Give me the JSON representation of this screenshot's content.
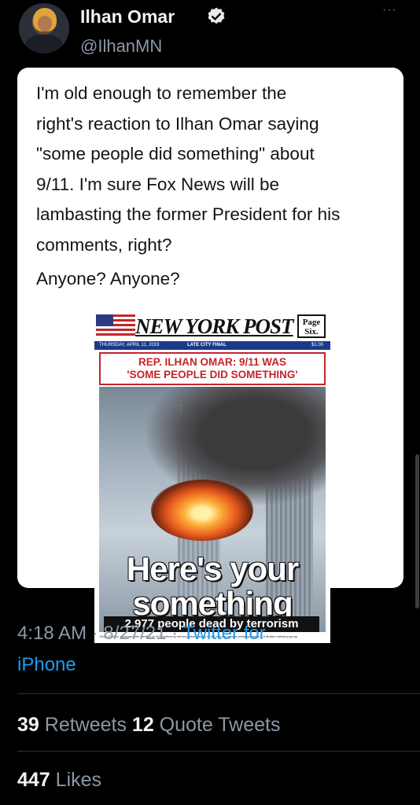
{
  "tweet": {
    "author_name": "Ilhan Omar",
    "author_handle": "@IlhanMN",
    "more_label": "···",
    "quoted_text": [
      "I'm old enough to remember the",
      "right's reaction to Ilhan Omar saying",
      "\"some people did something\" about",
      "9/11. I'm sure Fox News will be",
      "lambasting the former President for his",
      "comments, right?"
    ],
    "quoted_text_2": "Anyone? Anyone?",
    "timestamp": "4:18 AM · 8/27/21 · ",
    "source_line1": "Twitter for",
    "source_line2": "iPhone",
    "retweets_count": "39",
    "retweets_label": " Retweets ",
    "quotes_count": "12",
    "quotes_label": " Quote Tweets",
    "likes_count": "447",
    "likes_label": " Likes"
  },
  "newspaper": {
    "masthead": "NEW YORK POST",
    "page_six": "Page Six.",
    "dateline": "THURSDAY, APRIL 11, 2019",
    "edition": "LATE CITY FINAL",
    "price": "$1.00",
    "banner_line1": "REP. ILHAN OMAR: 9/11 WAS",
    "banner_line2": "'SOME PEOPLE DID SOMETHING'",
    "headline_line1": "Here's your",
    "headline_line2": "something",
    "subhead": "2,977 people dead by terrorism",
    "fine_print": "Omar (D-Minn.) outraged the families of 9/11 victims by referring dismissively to the terrorist attacks while speaking to a Muslim lobbying group."
  },
  "colors": {
    "background": "#000000",
    "link": "#1d9bf0",
    "muted": "#8b98a5",
    "post_red": "#c3252b",
    "post_blue": "#1b3a8a"
  },
  "icons": {
    "verified": "verified-badge-icon",
    "more": "more-options-icon"
  }
}
